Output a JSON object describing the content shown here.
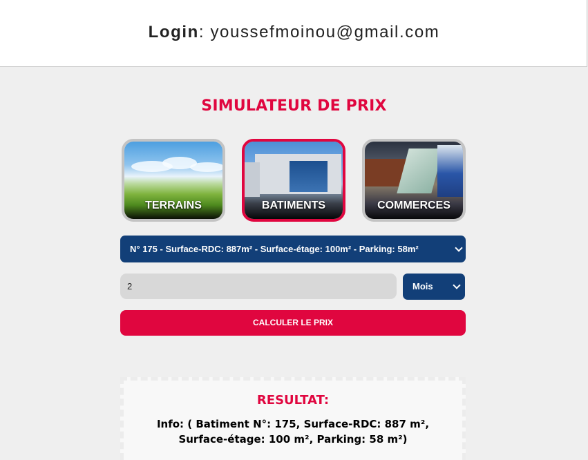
{
  "header": {
    "login_label": "Login",
    "login_sep": ": ",
    "email": "youssefmoinou@gmail.com"
  },
  "simulator": {
    "title": "SIMULATEUR DE PRIX",
    "categories": [
      {
        "label": "TERRAINS",
        "active": false
      },
      {
        "label": "BATIMENTS",
        "active": true
      },
      {
        "label": "COMMERCES",
        "active": false
      }
    ],
    "property_select": "N° 175 - Surface-RDC: 887m² - Surface-étage: 100m² - Parking: 58m²",
    "duration_value": "2",
    "duration_unit": "Mois",
    "submit_label": "CALCULER LE PRIX"
  },
  "result": {
    "title": "RESULTAT:",
    "info": "Info: ( Batiment N°: 175, Surface-RDC: 887 m², Surface-étage: 100 m², Parking: 58 m²)"
  },
  "colors": {
    "accent": "#e0063f",
    "primary": "#123f78"
  }
}
